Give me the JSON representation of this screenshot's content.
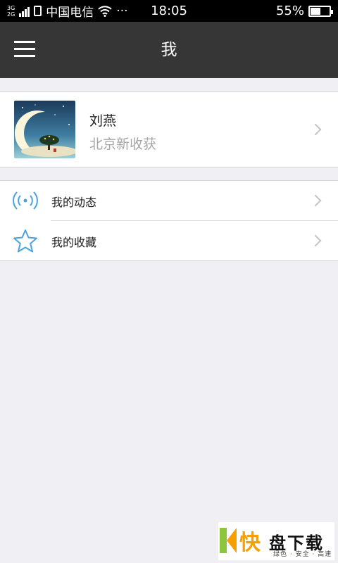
{
  "status_bar": {
    "network_top": "3G",
    "network_bottom": "2G",
    "carrier": "中国电信",
    "more": "···",
    "time": "18:05",
    "battery_percent_text": "55%",
    "battery_level": 0.55
  },
  "header": {
    "title": "我",
    "menu_icon": "hamburger-menu-icon"
  },
  "profile": {
    "name": "刘燕",
    "subtitle": "北京新收获",
    "avatar_icon": "moon-tree-night-avatar"
  },
  "menu": {
    "items": [
      {
        "label": "我的动态",
        "icon": "broadcast-signal-icon"
      },
      {
        "label": "我的收藏",
        "icon": "star-outline-icon"
      }
    ]
  },
  "watermark": {
    "char": "快",
    "brand": "盘下载",
    "tagline": "绿色 · 安全 · 高速"
  },
  "colors": {
    "header_bg": "#363636",
    "page_bg": "#efeff4",
    "icon_blue": "#4aa3df",
    "subtitle_gray": "#a6a6a6"
  }
}
